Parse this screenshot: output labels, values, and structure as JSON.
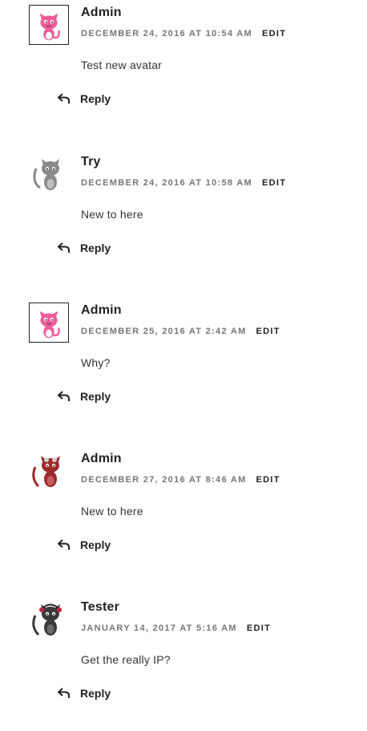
{
  "comments": [
    {
      "author": "Admin",
      "date": "December 24, 2016 at 10:54 am",
      "edit_label": "Edit",
      "text": "Test new avatar",
      "reply_label": "Reply",
      "avatar_icon": "pink-cat-avatar-icon",
      "avatar_color": "#f25a9a"
    },
    {
      "author": "Try",
      "date": "December 24, 2016 at 10:58 am",
      "edit_label": "Edit",
      "text": "New to here",
      "reply_label": "Reply",
      "avatar_icon": "gray-cat-avatar-icon",
      "avatar_color": "#8a8a8a"
    },
    {
      "author": "Admin",
      "date": "December 25, 2016 at 2:42 am",
      "edit_label": "Edit",
      "text": "Why?",
      "reply_label": "Reply",
      "avatar_icon": "pink-cat-avatar-icon",
      "avatar_color": "#f25a9a"
    },
    {
      "author": "Admin",
      "date": "December 27, 2016 at 8:46 am",
      "edit_label": "Edit",
      "text": "New to here",
      "reply_label": "Reply",
      "avatar_icon": "red-cat-avatar-icon",
      "avatar_color": "#9e2a2a"
    },
    {
      "author": "Tester",
      "date": "January 14, 2017 at 5:16 am",
      "edit_label": "Edit",
      "text": "Get the really IP?",
      "reply_label": "Reply",
      "avatar_icon": "black-cat-avatar-icon",
      "avatar_color": "#3a3a3a"
    }
  ]
}
